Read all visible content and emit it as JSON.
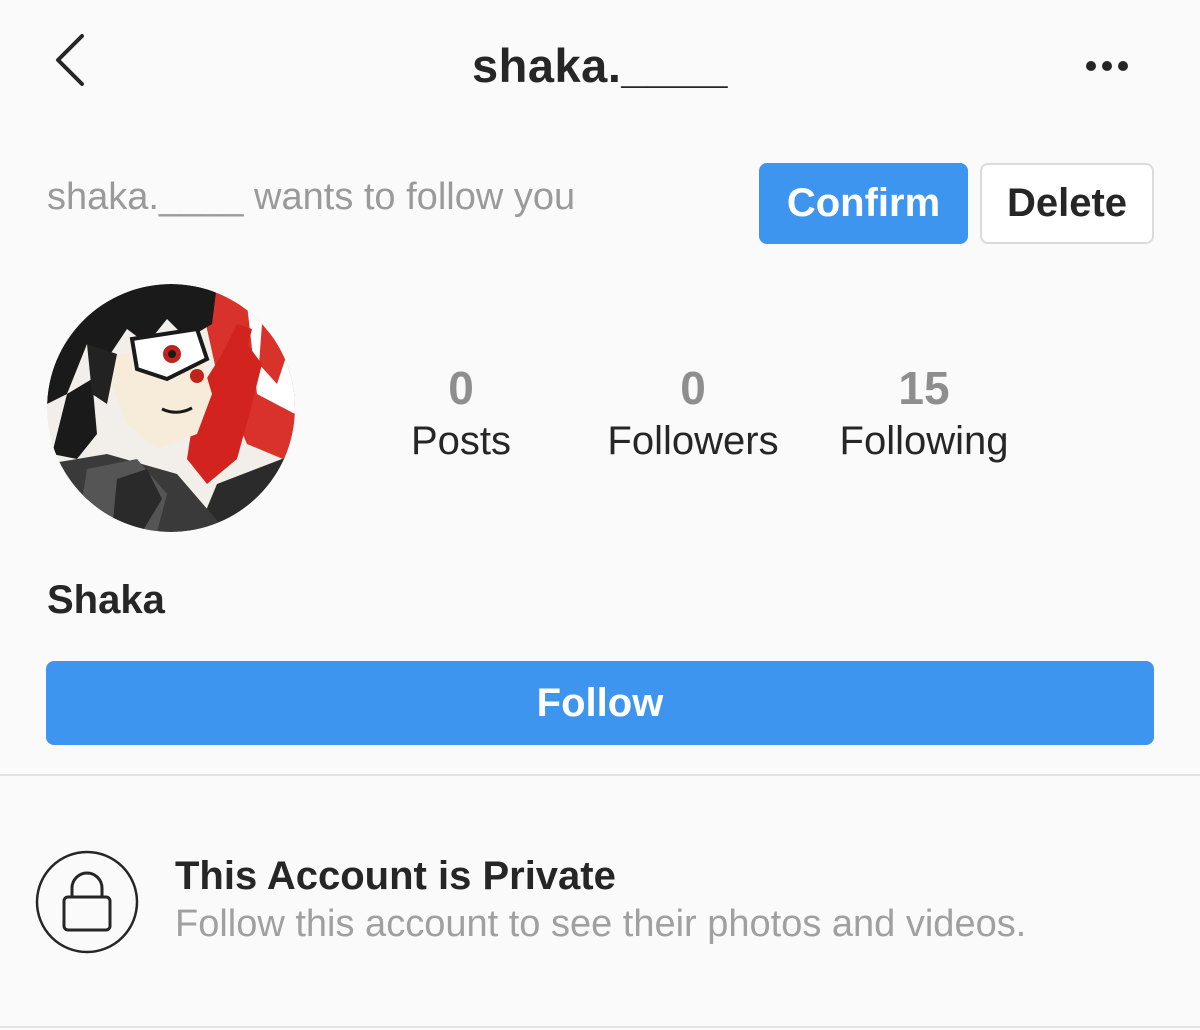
{
  "header": {
    "title": "shaka.____",
    "back_icon": "chevron-left-icon",
    "more_icon": "more-horizontal-icon"
  },
  "follow_request": {
    "text": "shaka.____ wants to follow you",
    "confirm_label": "Confirm",
    "delete_label": "Delete"
  },
  "profile": {
    "avatar": "anime-character-avatar",
    "name": "Shaka",
    "stats": [
      {
        "count": "0",
        "label": "Posts"
      },
      {
        "count": "0",
        "label": "Followers"
      },
      {
        "count": "15",
        "label": "Following"
      }
    ],
    "follow_label": "Follow"
  },
  "private_notice": {
    "icon": "lock-icon",
    "title": "This Account is Private",
    "subtitle": "Follow this account to see their photos and videos."
  },
  "colors": {
    "accent": "#3e95ef",
    "background": "#fafafa",
    "text_primary": "#262626",
    "text_secondary": "#9a9a9a",
    "border": "#dbdbdb"
  }
}
